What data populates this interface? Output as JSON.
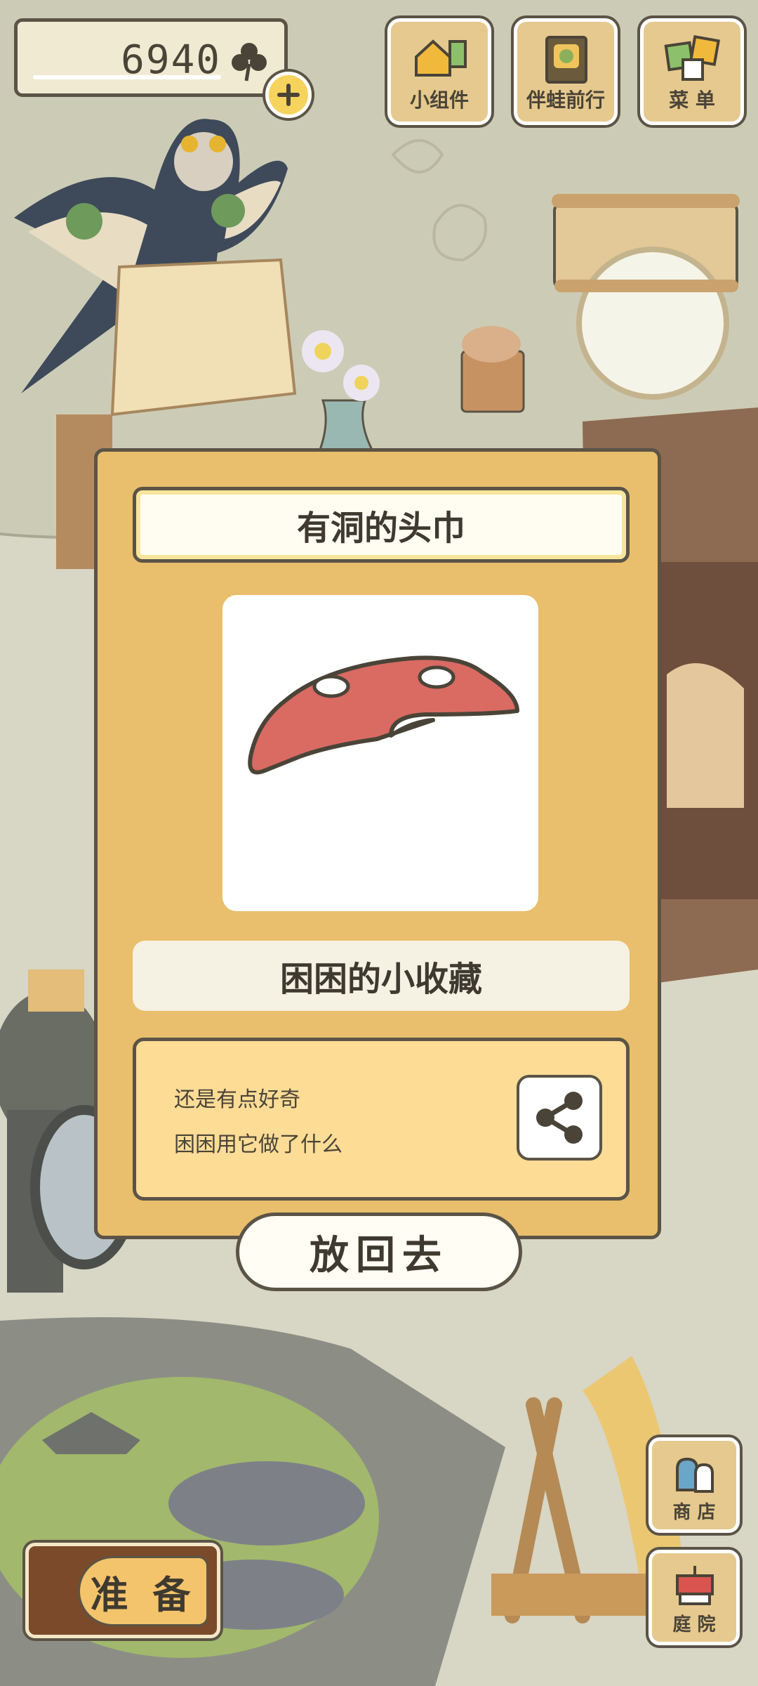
{
  "top_bar": {
    "clover_count": "6940",
    "widgets_label": "小组件",
    "travel_label": "伴蛙前行",
    "menu_label": "菜 单"
  },
  "item_dialog": {
    "item_name": "有洞的头巾",
    "collection_name": "困困的小收藏",
    "description_lines": [
      "还是有点好奇",
      "困困用它做了什么"
    ],
    "return_label": "放回去"
  },
  "bottom": {
    "prepare_label": "准 备",
    "shop_label": "商 店",
    "yard_label": "庭 院"
  },
  "colors": {
    "dialog_bg": "#e9be6c",
    "outline": "#5b5446",
    "bandana": "#d96b63"
  },
  "icons": [
    "clover-icon",
    "plus-icon",
    "widgets-icon",
    "travel-icon",
    "menu-icon",
    "share-icon",
    "shop-icon",
    "yard-icon"
  ]
}
